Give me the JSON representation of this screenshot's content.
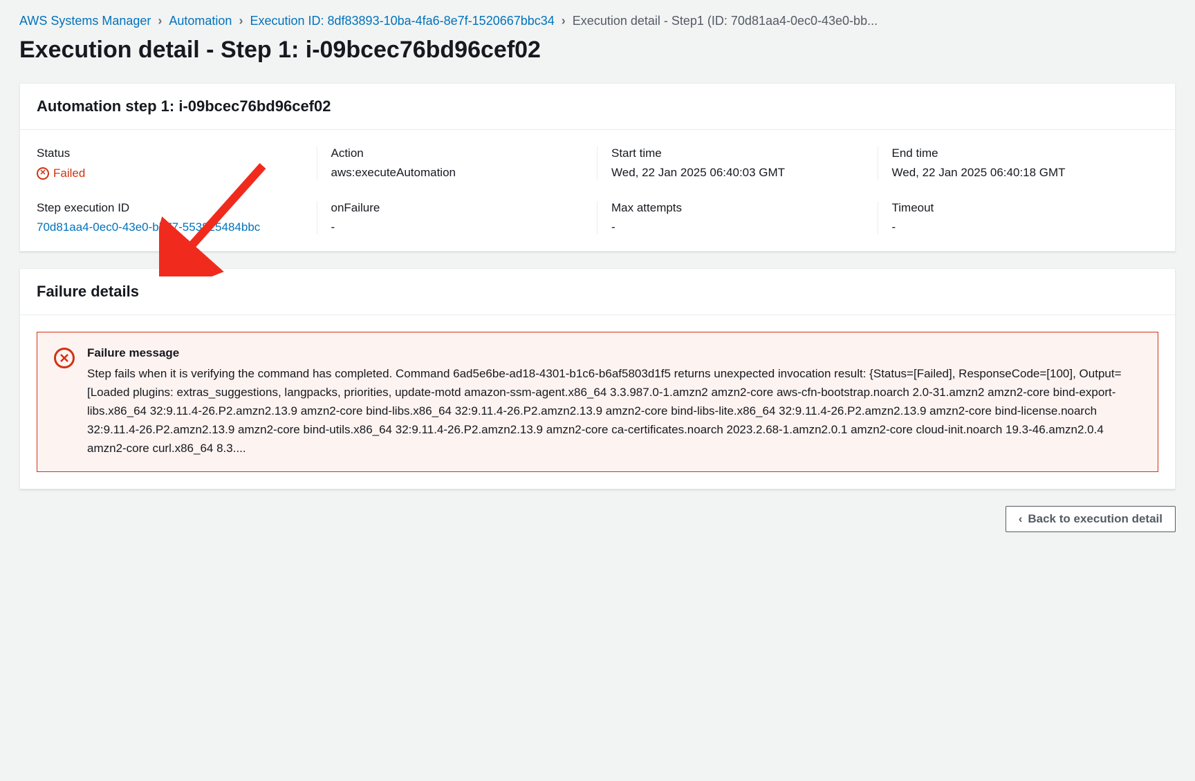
{
  "breadcrumb": {
    "items": [
      {
        "label": "AWS Systems Manager"
      },
      {
        "label": "Automation"
      },
      {
        "label": "Execution ID: 8df83893-10ba-4fa6-8e7f-1520667bbc34"
      }
    ],
    "current": "Execution detail - Step1 (ID: 70d81aa4-0ec0-43e0-bb..."
  },
  "page_title": "Execution detail - Step 1: i-09bcec76bd96cef02",
  "panel_step": {
    "title": "Automation step 1: i-09bcec76bd96cef02",
    "fields": {
      "status_label": "Status",
      "status_value": "Failed",
      "action_label": "Action",
      "action_value": "aws:executeAutomation",
      "start_label": "Start time",
      "start_value": "Wed, 22 Jan 2025 06:40:03 GMT",
      "end_label": "End time",
      "end_value": "Wed, 22 Jan 2025 06:40:18 GMT",
      "step_id_label": "Step execution ID",
      "step_id_value": "70d81aa4-0ec0-43e0-bb77-553825484bbc",
      "onfailure_label": "onFailure",
      "onfailure_value": "-",
      "max_label": "Max attempts",
      "max_value": "-",
      "timeout_label": "Timeout",
      "timeout_value": "-"
    }
  },
  "panel_failure": {
    "title": "Failure details",
    "message_title": "Failure message",
    "message_body": "Step fails when it is verifying the command has completed. Command 6ad5e6be-ad18-4301-b1c6-b6af5803d1f5 returns unexpected invocation result: {Status=[Failed], ResponseCode=[100], Output=[Loaded plugins: extras_suggestions, langpacks, priorities, update-motd amazon-ssm-agent.x86_64 3.3.987.0-1.amzn2 amzn2-core aws-cfn-bootstrap.noarch 2.0-31.amzn2 amzn2-core bind-export-libs.x86_64 32:9.11.4-26.P2.amzn2.13.9 amzn2-core bind-libs.x86_64 32:9.11.4-26.P2.amzn2.13.9 amzn2-core bind-libs-lite.x86_64 32:9.11.4-26.P2.amzn2.13.9 amzn2-core bind-license.noarch 32:9.11.4-26.P2.amzn2.13.9 amzn2-core bind-utils.x86_64 32:9.11.4-26.P2.amzn2.13.9 amzn2-core ca-certificates.noarch 2023.2.68-1.amzn2.0.1 amzn2-core cloud-init.noarch 19.3-46.amzn2.0.4 amzn2-core curl.x86_64 8.3...."
  },
  "footer": {
    "back_label": "Back to execution detail"
  }
}
